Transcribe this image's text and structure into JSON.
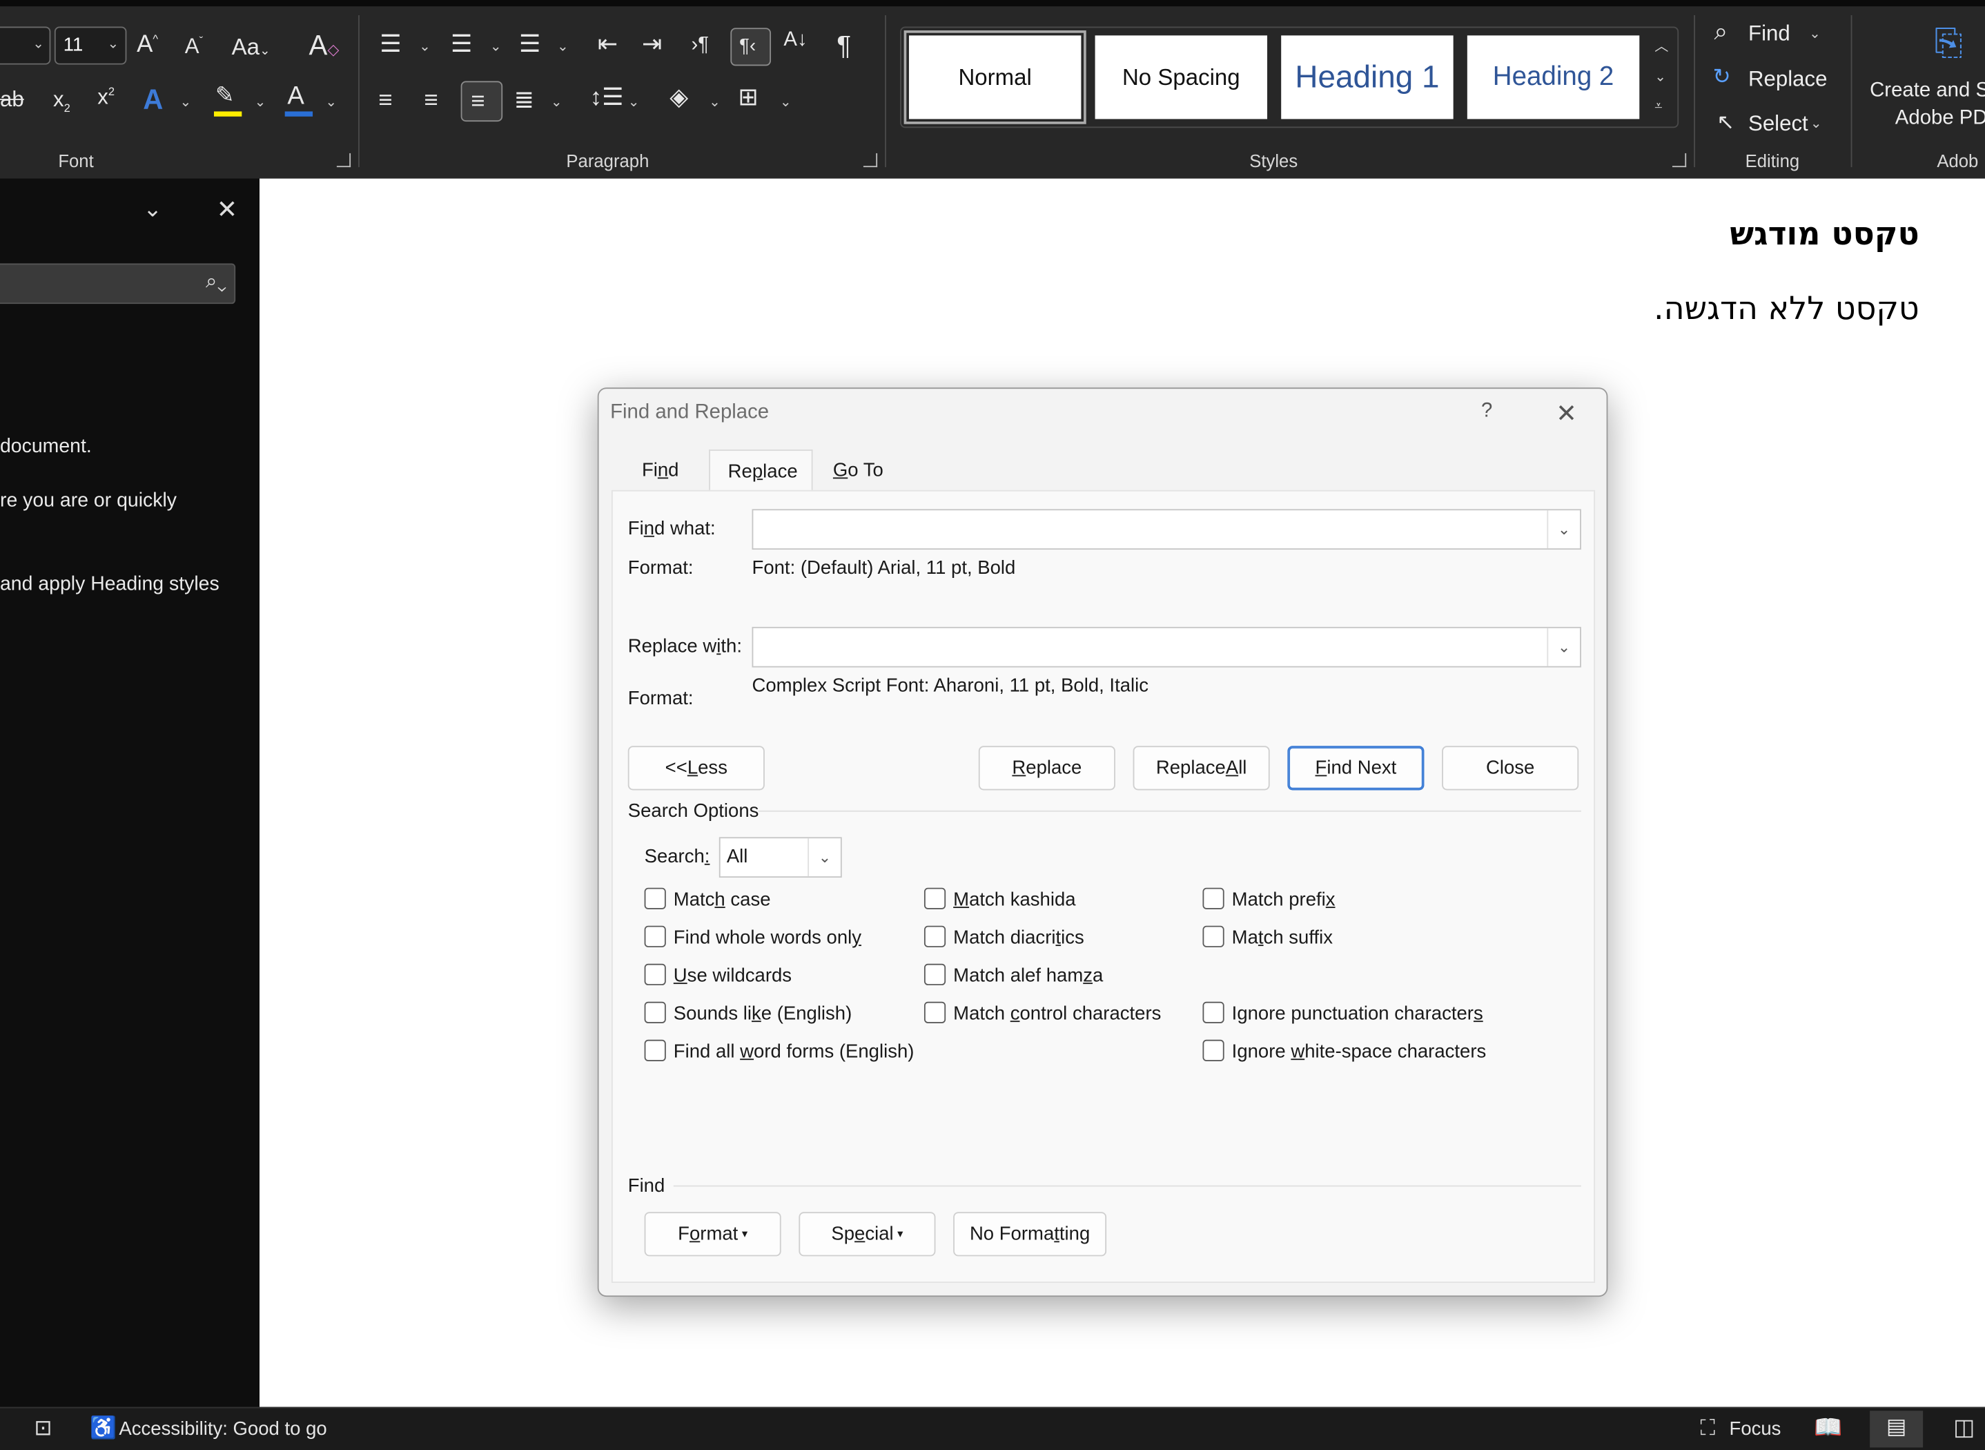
{
  "ribbon": {
    "font_size": "11",
    "groups": {
      "font": "Font",
      "paragraph": "Paragraph",
      "styles": "Styles",
      "editing": "Editing",
      "adobe": "Adob"
    },
    "styles_gallery": [
      "Normal",
      "No Spacing",
      "Heading 1",
      "Heading 2"
    ],
    "editing": {
      "find": "Find",
      "replace": "Replace",
      "select": "Select"
    },
    "adobe": {
      "line1": "Create and S",
      "line2": "Adobe PD"
    }
  },
  "nav_pane": {
    "line1": "document.",
    "line2": "re you are or quickly",
    "line3": "and apply Heading styles"
  },
  "document": {
    "line1": "טקסט מודגש",
    "line2": "טקסט ללא הדגשה."
  },
  "dialog": {
    "title": "Find and Replace",
    "help": "?",
    "tabs": {
      "find": "Find",
      "replace": "Replace",
      "goto": "Go To"
    },
    "find_what_label": "Find what:",
    "find_what_value": "",
    "find_format_label": "Format:",
    "find_format_value": "Font: (Default) Arial, 11 pt, Bold",
    "replace_with_label": "Replace with:",
    "replace_with_value": "",
    "replace_format_label": "Format:",
    "replace_format_value": "Complex Script Font: Aharoni, 11 pt, Bold, Italic",
    "buttons": {
      "less": "<< Less",
      "replace": "Replace",
      "replace_all": "Replace All",
      "find_next": "Find Next",
      "close": "Close"
    },
    "search_options_label": "Search Options",
    "search_label": "Search:",
    "search_value": "All",
    "options": {
      "match_case": "Match case",
      "whole_words": "Find whole words only",
      "wildcards": "Use wildcards",
      "sounds_like": "Sounds like (English)",
      "word_forms": "Find all word forms (English)",
      "kashida": "Match kashida",
      "diacritics": "Match diacritics",
      "alef_hamza": "Match alef hamza",
      "control_chars": "Match control characters",
      "prefix": "Match prefix",
      "suffix": "Match suffix",
      "ignore_punct": "Ignore punctuation characters",
      "ignore_space": "Ignore white-space characters"
    },
    "find_section_label": "Find",
    "bottom_buttons": {
      "format": "Format",
      "special": "Special",
      "no_formatting": "No Formatting"
    }
  },
  "status_bar": {
    "accessibility": "Accessibility: Good to go",
    "focus": "Focus"
  }
}
